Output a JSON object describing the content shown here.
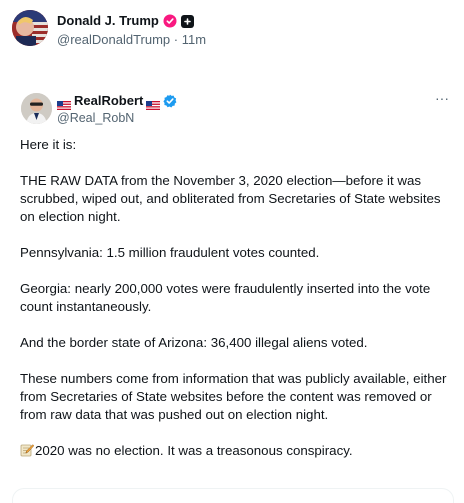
{
  "outer_post": {
    "display_name": "Donald J. Trump",
    "handle": "@realDonaldTrump",
    "separator": "·",
    "time": "11m"
  },
  "quoted_post": {
    "display_name": "RealRobert",
    "handle": "@Real_RobN",
    "more_label": "···",
    "paragraphs": [
      "Here it is:",
      "THE RAW DATA from the November 3, 2020 election—before it was scrubbed, wiped out, and obliterated from Secretaries of State websites on election night.",
      "Pennsylvania: 1.5 million fraudulent votes counted.",
      "Georgia: nearly 200,000 votes were fraudulently inserted into the vote count instantaneously.",
      "And the border state of Arizona: 36,400 illegal aliens voted.",
      "These numbers come from information that was publicly available, either from Secretaries of State websites before the content was removed or from raw data that was pushed out on election night."
    ],
    "last_line": "2020 was no election. It was a treasonous conspiracy."
  },
  "colors": {
    "text_primary": "#0f1419",
    "text_secondary": "#536471",
    "verified_blue": "#1d9bf0",
    "badge_pink": "#f91880"
  },
  "icons": {
    "outer_badge": "pink-badge-icon",
    "outer_square": "square-plus-icon",
    "verified": "verified-check-icon",
    "flag": "us-flag-icon",
    "memo": "memo-pencil-icon",
    "more": "more-horizontal-icon"
  }
}
